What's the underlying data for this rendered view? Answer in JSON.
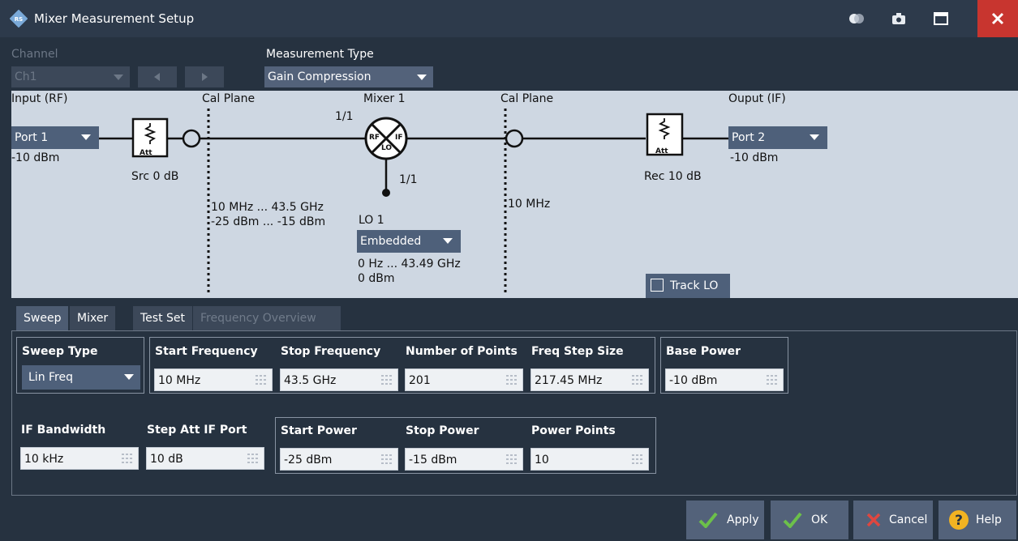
{
  "window": {
    "title": "Mixer Measurement Setup"
  },
  "titlebar": {
    "icons": [
      "toggle-icon",
      "camera-icon",
      "maximize-icon",
      "close-icon"
    ]
  },
  "channel": {
    "label": "Channel",
    "value": "Ch1"
  },
  "measurement_type": {
    "label": "Measurement Type",
    "value": "Gain Compression"
  },
  "diagram": {
    "input_label": "Input (RF)",
    "input_port": "Port 1",
    "input_power": "-10 dBm",
    "src_att": "Src 0 dB",
    "att_text": "Att",
    "cal_plane_left": "Cal Plane",
    "cal_plane_right": "Cal Plane",
    "mixer_label": "Mixer 1",
    "mixer_ratio_rf": "1/1",
    "mixer_ratio_lo": "1/1",
    "mixer_rf": "RF",
    "mixer_if": "IF",
    "mixer_lo": "LO",
    "rf_freq_range": "10 MHz ... 43.5 GHz",
    "rf_power_range": "-25 dBm ... -15 dBm",
    "lo_label": "LO 1",
    "lo_mode": "Embedded",
    "lo_freq_range": "0 Hz ... 43.49 GHz",
    "lo_power": "0 dBm",
    "if_freq": "10 MHz",
    "rec_att": "Rec 10 dB",
    "output_label": "Ouput (IF)",
    "output_port": "Port 2",
    "output_power": "-10 dBm",
    "track_lo": "Track LO"
  },
  "tabs": [
    {
      "label": "Sweep",
      "active": true
    },
    {
      "label": "Mixer",
      "active": false
    },
    {
      "label": "Test Set",
      "active": false
    },
    {
      "label": "Frequency Overview",
      "active": false,
      "disabled": true
    }
  ],
  "sweep": {
    "sweep_type": {
      "label": "Sweep Type",
      "value": "Lin Freq"
    },
    "start_frequency": {
      "label": "Start Frequency",
      "value": "10 MHz"
    },
    "stop_frequency": {
      "label": "Stop Frequency",
      "value": "43.5 GHz"
    },
    "number_of_points": {
      "label": "Number of Points",
      "value": "201"
    },
    "freq_step_size": {
      "label": "Freq Step Size",
      "value": "217.45 MHz"
    },
    "base_power": {
      "label": "Base Power",
      "value": "-10 dBm"
    },
    "if_bandwidth": {
      "label": "IF Bandwidth",
      "value": "10 kHz"
    },
    "step_att_if_port": {
      "label": "Step Att IF Port",
      "value": "10 dB"
    },
    "start_power": {
      "label": "Start Power",
      "value": "-25 dBm"
    },
    "stop_power": {
      "label": "Stop Power",
      "value": "-15 dBm"
    },
    "power_points": {
      "label": "Power Points",
      "value": "10"
    }
  },
  "buttons": {
    "apply": "Apply",
    "ok": "OK",
    "cancel": "Cancel",
    "help": "Help"
  },
  "colors": {
    "background": "#263240",
    "titlebar": "#2d3a4b",
    "close_red": "#c8352f",
    "diagram_bg": "#ced7e2",
    "control_blue": "#4e607a",
    "check_green": "#6cc04a",
    "cancel_red": "#e0463f",
    "help_yellow": "#f2b322"
  }
}
